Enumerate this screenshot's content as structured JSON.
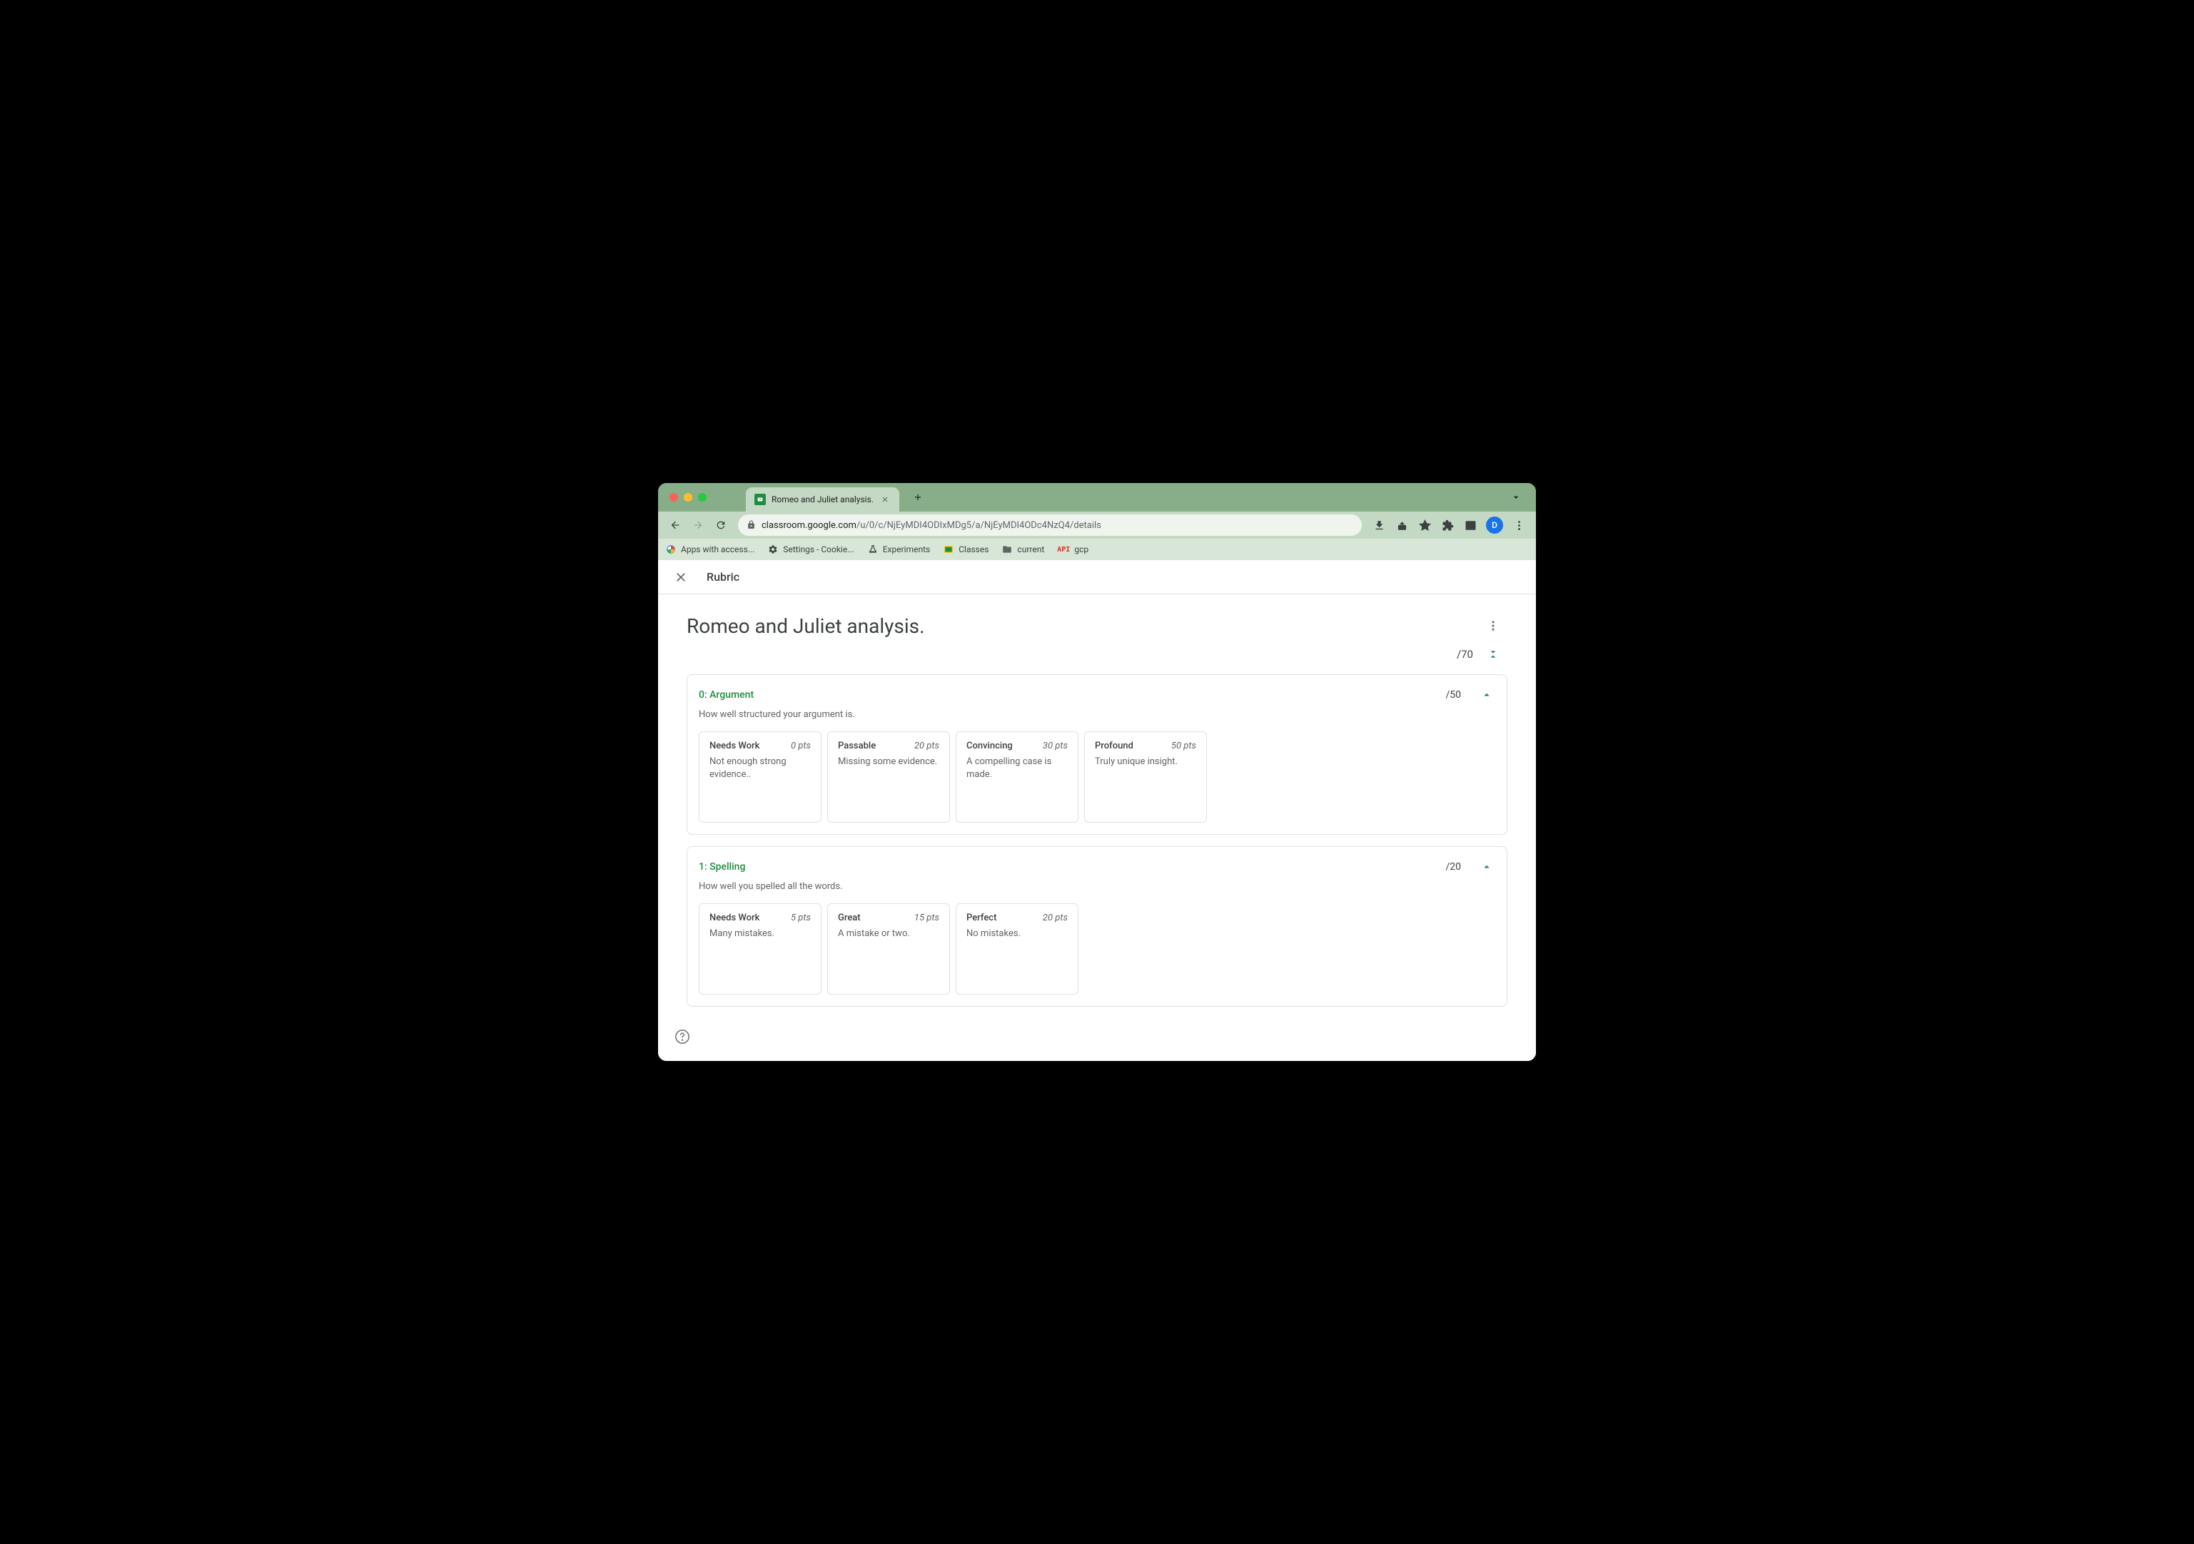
{
  "browser": {
    "tab_title": "Romeo and Juliet analysis.",
    "url_host": "classroom.google.com",
    "url_path": "/u/0/c/NjEyMDI4ODIxMDg5/a/NjEyMDI4ODc4NzQ4/details",
    "avatar_letter": "D"
  },
  "bookmarks": [
    {
      "label": "Apps with access..."
    },
    {
      "label": "Settings - Cookie..."
    },
    {
      "label": "Experiments"
    },
    {
      "label": "Classes"
    },
    {
      "label": "current"
    },
    {
      "label": "gcp"
    }
  ],
  "appbar": {
    "title": "Rubric"
  },
  "rubric": {
    "title": "Romeo and Juliet analysis.",
    "total_points": "/70",
    "criteria": [
      {
        "title": "0: Argument",
        "points": "/50",
        "description": "How well structured your argument is.",
        "levels": [
          {
            "name": "Needs Work",
            "points": "0 pts",
            "description": "Not enough strong evidence.."
          },
          {
            "name": "Passable",
            "points": "20 pts",
            "description": "Missing some evidence."
          },
          {
            "name": "Convincing",
            "points": "30 pts",
            "description": "A compelling case is made."
          },
          {
            "name": "Profound",
            "points": "50 pts",
            "description": "Truly unique insight."
          }
        ]
      },
      {
        "title": "1: Spelling",
        "points": "/20",
        "description": "How well you spelled all the words.",
        "levels": [
          {
            "name": "Needs Work",
            "points": "5 pts",
            "description": "Many mistakes."
          },
          {
            "name": "Great",
            "points": "15 pts",
            "description": "A mistake or two."
          },
          {
            "name": "Perfect",
            "points": "20 pts",
            "description": "No mistakes."
          }
        ]
      }
    ]
  }
}
